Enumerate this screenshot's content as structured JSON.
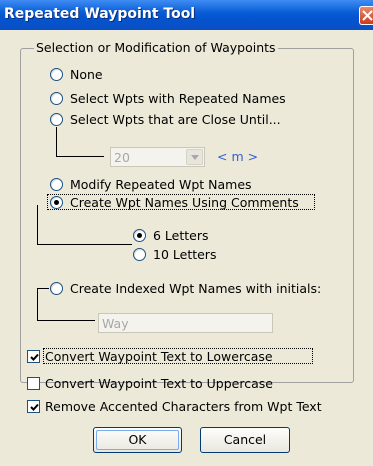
{
  "window": {
    "title": "Repeated Waypoint Tool",
    "close_icon": "close-icon"
  },
  "group": {
    "label": "Selection or Modification of Waypoints",
    "options": [
      {
        "label": "None",
        "checked": false
      },
      {
        "label": "Select Wpts with Repeated Names",
        "checked": false
      },
      {
        "label": "Select Wpts that are Close Until...",
        "checked": false
      },
      {
        "label": "Modify Repeated Wpt Names",
        "checked": false
      },
      {
        "label": "Create Wpt Names Using Comments",
        "checked": true
      },
      {
        "label": "Create Indexed Wpt Names with initials:",
        "checked": false
      }
    ],
    "distance": {
      "value": "20",
      "unit": "< m >"
    },
    "letters": [
      {
        "label": "6 Letters",
        "checked": true
      },
      {
        "label": "10 Letters",
        "checked": false
      }
    ],
    "initials": {
      "value": "Way"
    }
  },
  "checkboxes": [
    {
      "label": "Convert Waypoint Text to Lowercase",
      "checked": true
    },
    {
      "label": "Convert Waypoint Text to Uppercase",
      "checked": false
    },
    {
      "label": "Remove Accented Characters from Wpt Text",
      "checked": true
    }
  ],
  "buttons": {
    "ok": "OK",
    "cancel": "Cancel"
  }
}
